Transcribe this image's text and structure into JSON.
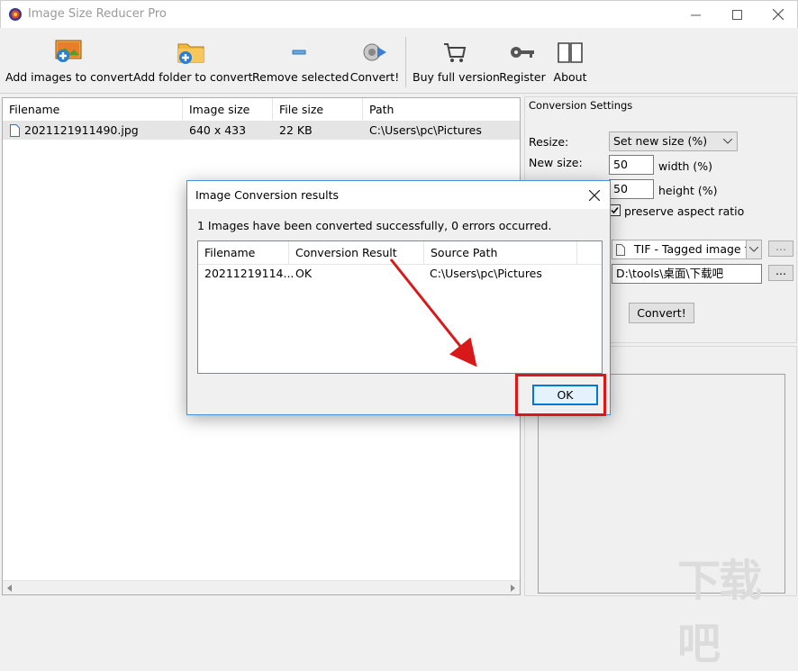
{
  "window": {
    "title": "Image Size Reducer Pro",
    "controls": [
      "minimize",
      "maximize",
      "close"
    ]
  },
  "toolbar": {
    "buttons": [
      {
        "label": "Add images to convert",
        "icon": "add-images-icon"
      },
      {
        "label": "Add folder to convert",
        "icon": "add-folder-icon"
      },
      {
        "label": "Remove selected",
        "icon": "remove-icon"
      },
      {
        "label": "Convert!",
        "icon": "convert-icon"
      },
      {
        "label": "Buy full version",
        "icon": "cart-icon"
      },
      {
        "label": "Register",
        "icon": "key-icon"
      },
      {
        "label": "About",
        "icon": "book-icon"
      }
    ]
  },
  "file_list": {
    "columns": [
      "Filename",
      "Image size",
      "File size",
      "Path"
    ],
    "rows": [
      {
        "filename": "2021121911490.jpg",
        "image_size": "640 x 433",
        "file_size": "22 KB",
        "path": "C:\\Users\\pc\\Pictures"
      }
    ]
  },
  "settings": {
    "section_title": "Conversion Settings",
    "resize_label": "Resize:",
    "resize_value": "Set new size (%)",
    "new_size_label": "New size:",
    "width_value": "50",
    "width_label": "width  (%)",
    "height_value": "50",
    "height_label": "height  (%)",
    "preserve_label": "preserve aspect ratio",
    "preserve_checked": true,
    "format_value": "TIF - Tagged image file",
    "browse_label": "...",
    "output_path": "D:\\tools\\桌面\\下载吧",
    "convert_label": "Convert!"
  },
  "dialog": {
    "title": "Image Conversion results",
    "message": "1 Images have been converted successfully, 0 errors occurred.",
    "columns": [
      "Filename",
      "Conversion Result",
      "Source Path"
    ],
    "rows": [
      {
        "filename": "20211219114...",
        "result": "OK",
        "source": "C:\\Users\\pc\\Pictures"
      }
    ],
    "ok_label": "OK"
  },
  "annotation": {
    "color": "#d81919"
  },
  "watermark": {
    "text": "下载吧"
  }
}
